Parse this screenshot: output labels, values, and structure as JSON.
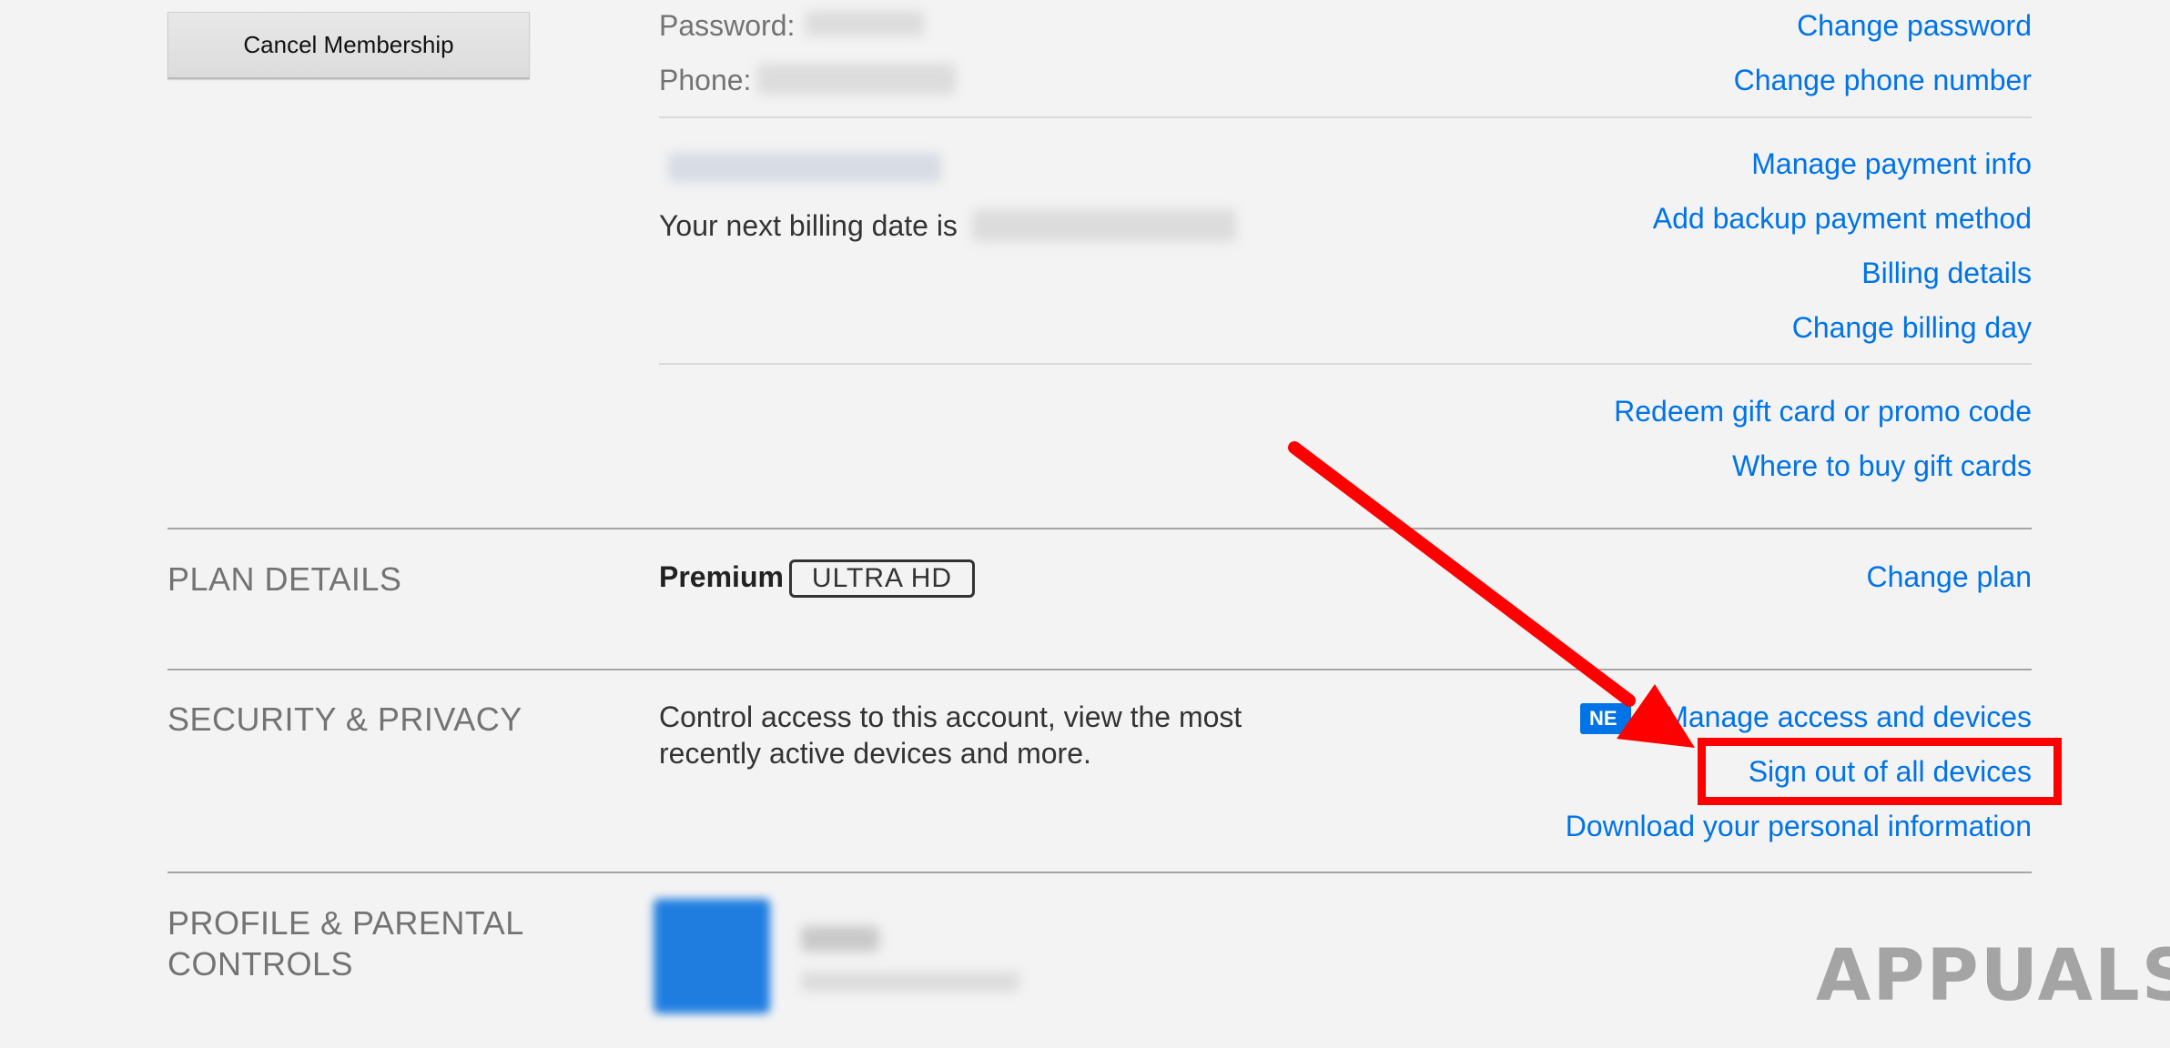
{
  "membership": {
    "cancel_button": "Cancel Membership",
    "password_label": "Password:",
    "phone_label": "Phone:",
    "change_password": "Change password",
    "change_phone": "Change phone number",
    "manage_payment": "Manage payment info",
    "billing_text": "Your next billing date is",
    "add_backup": "Add backup payment method",
    "billing_details": "Billing details",
    "change_billing_day": "Change billing day",
    "redeem_gift": "Redeem gift card or promo code",
    "where_buy": "Where to buy gift cards"
  },
  "plan": {
    "title": "PLAN DETAILS",
    "name": "Premium",
    "badge": "ULTRA HD",
    "change_plan": "Change plan"
  },
  "security": {
    "title": "SECURITY & PRIVACY",
    "description_line1": "Control access to this account, view the most",
    "description_line2": "recently active devices and more.",
    "new_badge": "NE",
    "manage_access": "Manage access and devices",
    "sign_out_all": "Sign out of all devices",
    "download_info": "Download your personal information"
  },
  "profile": {
    "title_line1": "PROFILE & PARENTAL",
    "title_line2": "CONTROLS"
  },
  "watermark": {
    "text": "APPUALS"
  },
  "colors": {
    "link": "#0073e6",
    "annotation": "#ff0000",
    "background": "#f3f3f3"
  }
}
